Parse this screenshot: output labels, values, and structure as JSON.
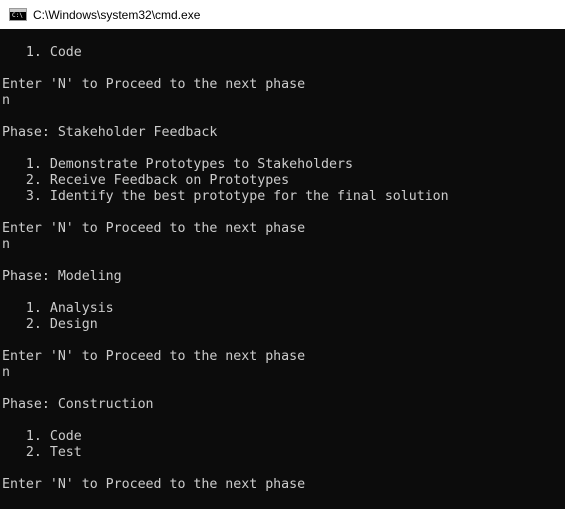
{
  "window": {
    "title": "C:\\Windows\\system32\\cmd.exe",
    "icon_prompt": "C:\\",
    "icon": "cmd-console-icon"
  },
  "console": {
    "lines": [
      "   1. Code",
      "",
      "Enter 'N' to Proceed to the next phase",
      "n",
      "",
      "Phase: Stakeholder Feedback",
      "",
      "   1. Demonstrate Prototypes to Stakeholders",
      "   2. Receive Feedback on Prototypes",
      "   3. Identify the best prototype for the final solution",
      "",
      "Enter 'N' to Proceed to the next phase",
      "n",
      "",
      "Phase: Modeling",
      "",
      "   1. Analysis",
      "   2. Design",
      "",
      "Enter 'N' to Proceed to the next phase",
      "n",
      "",
      "Phase: Construction",
      "",
      "   1. Code",
      "   2. Test",
      "",
      "Enter 'N' to Proceed to the next phase"
    ]
  },
  "colors": {
    "console_background": "#0c0c0c",
    "console_text": "#cccccc",
    "titlebar_background": "#ffffff"
  }
}
